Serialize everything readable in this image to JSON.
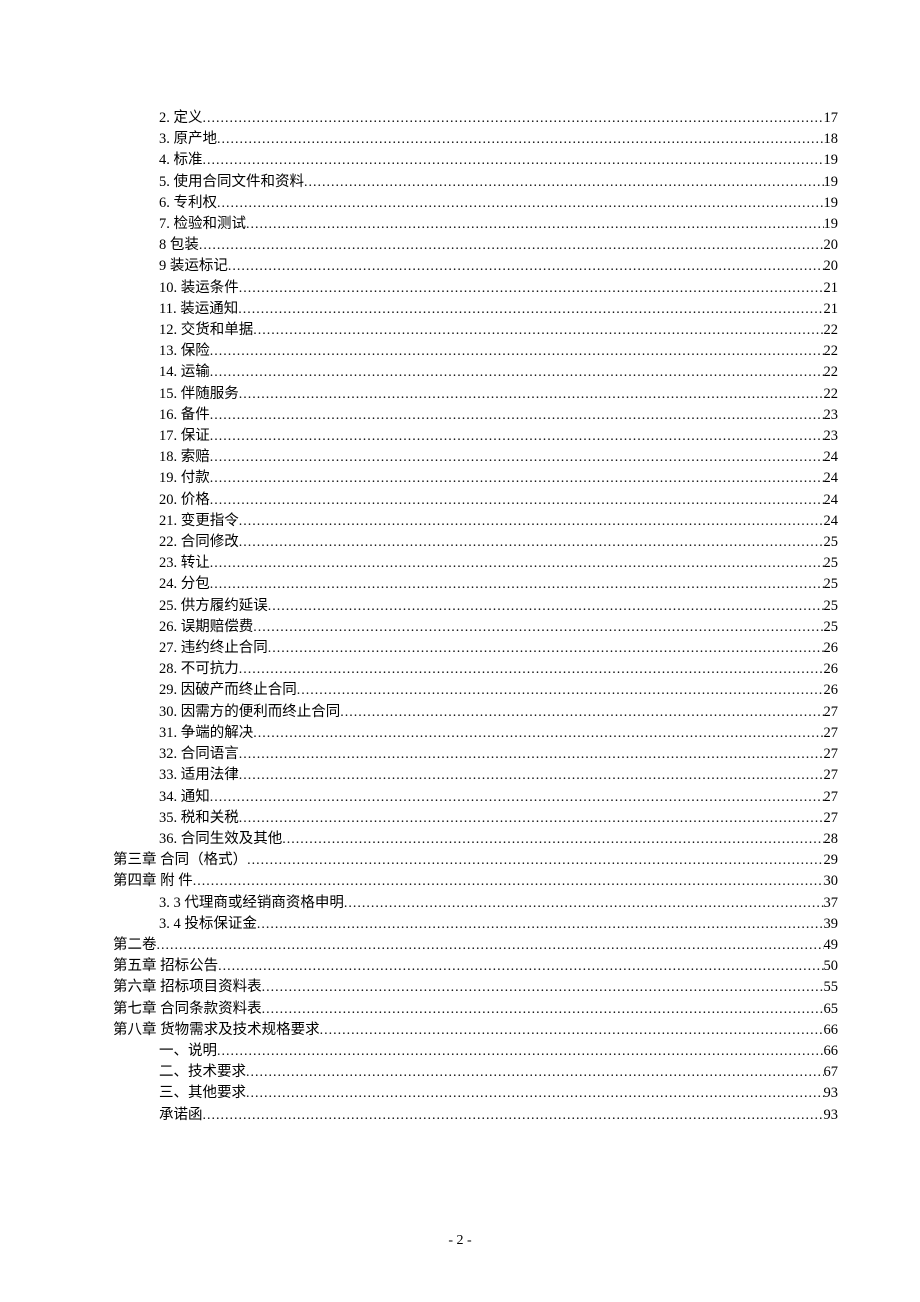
{
  "toc": [
    {
      "indent": 1,
      "label": "2. 定义",
      "page": "17"
    },
    {
      "indent": 1,
      "label": "3. 原产地",
      "page": "18"
    },
    {
      "indent": 1,
      "label": "4. 标准",
      "page": "19"
    },
    {
      "indent": 1,
      "label": "5. 使用合同文件和资料",
      "page": "19"
    },
    {
      "indent": 1,
      "label": "6. 专利权",
      "page": "19"
    },
    {
      "indent": 1,
      "label": "7. 检验和测试",
      "page": "19"
    },
    {
      "indent": 1,
      "label": "8 包装",
      "page": "20"
    },
    {
      "indent": 1,
      "label": "9 装运标记",
      "page": "20"
    },
    {
      "indent": 1,
      "label": "10. 装运条件",
      "page": "21"
    },
    {
      "indent": 1,
      "label": "11. 装运通知",
      "page": "21"
    },
    {
      "indent": 1,
      "label": "12. 交货和单据",
      "page": "22"
    },
    {
      "indent": 1,
      "label": "13. 保险",
      "page": "22"
    },
    {
      "indent": 1,
      "label": "14. 运输",
      "page": "22"
    },
    {
      "indent": 1,
      "label": "15. 伴随服务",
      "page": "22"
    },
    {
      "indent": 1,
      "label": "16. 备件",
      "page": "23"
    },
    {
      "indent": 1,
      "label": "17. 保证",
      "page": "23"
    },
    {
      "indent": 1,
      "label": "18. 索赔",
      "page": "24"
    },
    {
      "indent": 1,
      "label": "19. 付款",
      "page": "24"
    },
    {
      "indent": 1,
      "label": "20. 价格",
      "page": "24"
    },
    {
      "indent": 1,
      "label": "21. 变更指令",
      "page": "24"
    },
    {
      "indent": 1,
      "label": "22. 合同修改",
      "page": "25"
    },
    {
      "indent": 1,
      "label": "23. 转让",
      "page": "25"
    },
    {
      "indent": 1,
      "label": "24. 分包",
      "page": "25"
    },
    {
      "indent": 1,
      "label": "25. 供方履约延误",
      "page": "25"
    },
    {
      "indent": 1,
      "label": "26. 误期赔偿费",
      "page": "25"
    },
    {
      "indent": 1,
      "label": "27. 违约终止合同",
      "page": "26"
    },
    {
      "indent": 1,
      "label": "28. 不可抗力",
      "page": "26"
    },
    {
      "indent": 1,
      "label": "29. 因破产而终止合同",
      "page": "26"
    },
    {
      "indent": 1,
      "label": "30. 因需方的便利而终止合同",
      "page": "27"
    },
    {
      "indent": 1,
      "label": "31. 争端的解决",
      "page": "27"
    },
    {
      "indent": 1,
      "label": "32. 合同语言",
      "page": "27"
    },
    {
      "indent": 1,
      "label": "33. 适用法律",
      "page": "27"
    },
    {
      "indent": 1,
      "label": "34. 通知",
      "page": "27"
    },
    {
      "indent": 1,
      "label": "35. 税和关税",
      "page": "27"
    },
    {
      "indent": 1,
      "label": "36. 合同生效及其他",
      "page": "28"
    },
    {
      "indent": 0,
      "label": "第三章 合同（格式）",
      "page": "29"
    },
    {
      "indent": 0,
      "label": "第四章 附  件",
      "page": "30"
    },
    {
      "indent": 1,
      "label": "3. 3 代理商或经销商资格申明",
      "page": "37"
    },
    {
      "indent": 1,
      "label": "3. 4 投标保证金",
      "page": "39"
    },
    {
      "indent": 0,
      "label": "第二卷",
      "page": "49"
    },
    {
      "indent": 0,
      "label": "第五章 招标公告",
      "page": "50"
    },
    {
      "indent": 0,
      "label": "第六章 招标项目资料表",
      "page": "55"
    },
    {
      "indent": 0,
      "label": "第七章 合同条款资料表",
      "page": "65"
    },
    {
      "indent": 0,
      "label": "第八章 货物需求及技术规格要求",
      "page": "66"
    },
    {
      "indent": 1,
      "label": "一、说明",
      "page": "66"
    },
    {
      "indent": 1,
      "label": "二、技术要求",
      "page": "67"
    },
    {
      "indent": 1,
      "label": "三、其他要求",
      "page": "93"
    },
    {
      "indent": 1,
      "label": "承诺函",
      "page": "93"
    }
  ],
  "footer": {
    "page_number": "- 2 -"
  }
}
